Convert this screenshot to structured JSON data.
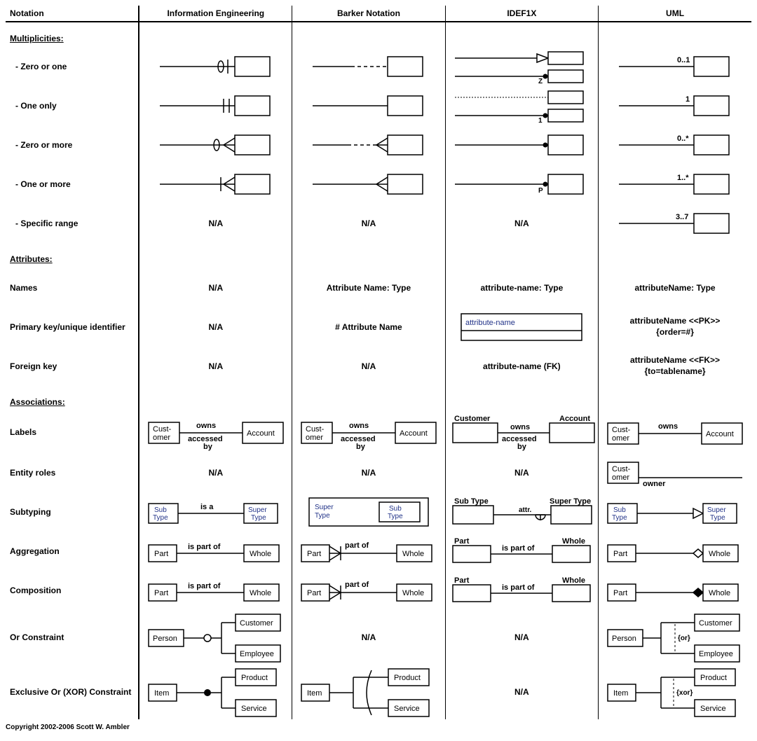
{
  "chart_data": {
    "type": "table",
    "columns": [
      "Notation",
      "Information Engineering",
      "Barker Notation",
      "IDEF1X",
      "UML"
    ],
    "sections": [
      {
        "title": "Multiplicities:",
        "rows": [
          {
            "label": "- Zero or one",
            "cells": [
              "diagram",
              "diagram",
              "diagram",
              "diagram"
            ],
            "uml_label": "0..1",
            "idef1x_label": "Z"
          },
          {
            "label": "- One only",
            "cells": [
              "diagram",
              "diagram",
              "diagram",
              "diagram"
            ],
            "uml_label": "1",
            "idef1x_label": "1"
          },
          {
            "label": "- Zero or more",
            "cells": [
              "diagram",
              "diagram",
              "diagram",
              "diagram"
            ],
            "uml_label": "0..*"
          },
          {
            "label": "- One or more",
            "cells": [
              "diagram",
              "diagram",
              "diagram",
              "diagram"
            ],
            "uml_label": "1..*",
            "idef1x_label": "P"
          },
          {
            "label": "- Specific range",
            "cells": [
              "N/A",
              "N/A",
              "N/A",
              "diagram"
            ],
            "uml_label": "3..7"
          }
        ]
      },
      {
        "title": "Attributes:",
        "rows": [
          {
            "label": "Names",
            "cells": [
              "N/A",
              "Attribute Name: Type",
              "attribute-name: Type",
              "attributeName: Type"
            ]
          },
          {
            "label": "Primary key/unique identifier",
            "cells": [
              "N/A",
              "# Attribute Name",
              "diagram-pkbox",
              "attributeName <<PK>> {order=#}"
            ]
          },
          {
            "label": "Foreign key",
            "cells": [
              "N/A",
              "N/A",
              "attribute-name (FK)",
              "attributeName <<FK>> {to=tablename}"
            ]
          }
        ]
      },
      {
        "title": "Associations:",
        "rows": [
          {
            "label": "Labels",
            "cells": [
              "Customer owns / accessed by Account",
              "Customer owns / accessed by Account",
              "Customer owns / accessed by Account",
              "Customer owns Account"
            ]
          },
          {
            "label": "Entity roles",
            "cells": [
              "N/A",
              "N/A",
              "N/A",
              "Customer owner"
            ]
          },
          {
            "label": "Subtyping",
            "cells": [
              "SubType is a SuperType",
              "SuperType contains SubType",
              "SubType attr. SuperType",
              "SubType ▷ SuperType"
            ]
          },
          {
            "label": "Aggregation",
            "cells": [
              "Part is part of Whole",
              "Part part of Whole",
              "Part is part of Whole",
              "Part ◇ Whole"
            ]
          },
          {
            "label": "Composition",
            "cells": [
              "Part is part of Whole",
              "Part part of Whole",
              "Part is part of Whole",
              "Part ◆ Whole"
            ]
          },
          {
            "label": "Or Constraint",
            "cells": [
              "Person→Customer/Employee",
              "N/A",
              "N/A",
              "Person {or} Customer/Employee"
            ]
          },
          {
            "label": "Exclusive Or (XOR) Constraint",
            "cells": [
              "Item→Product/Service",
              "Item arc Product/Service",
              "N/A",
              "Item {xor} Product/Service"
            ]
          }
        ]
      }
    ]
  },
  "headers": {
    "c0": "Notation",
    "c1": "Information Engineering",
    "c2": "Barker Notation",
    "c3": "IDEF1X",
    "c4": "UML"
  },
  "sections": {
    "mult": "Multiplicities:",
    "attr": "Attributes:",
    "assoc": "Associations:"
  },
  "rows": {
    "zero_one": "- Zero or one",
    "one_only": "- One only",
    "zero_more": "- Zero or more",
    "one_more": "- One or more",
    "specific": "- Specific range",
    "names": "Names",
    "pk": "Primary key/unique identifier",
    "fk": "Foreign key",
    "labels": "Labels",
    "roles": "Entity roles",
    "subtype": "Subtyping",
    "aggreg": "Aggregation",
    "compos": "Composition",
    "orc": "Or Constraint",
    "xor": "Exclusive Or (XOR) Constraint"
  },
  "text": {
    "na": "N/A",
    "attr_barker": "Attribute Name: Type",
    "attr_idef": "attribute-name: Type",
    "attr_uml": "attributeName: Type",
    "pk_barker": "# Attribute Name",
    "pk_idef_box": "attribute-name",
    "pk_uml_l1": "attributeName <<PK>>",
    "pk_uml_l2": "{order=#}",
    "fk_idef": "attribute-name (FK)",
    "fk_uml_l1": "attributeName <<FK>>",
    "fk_uml_l2": "{to=tablename}",
    "uml_01": "0..1",
    "uml_1": "1",
    "uml_0s": "0..*",
    "uml_1s": "1..*",
    "uml_37": "3..7",
    "idef_z": "Z",
    "idef_1": "1",
    "idef_p": "P",
    "customer": "Customer",
    "cust": "Cust-",
    "omer": "omer",
    "account": "Account",
    "owns": "owns",
    "accessed": "accessed",
    "by": "by",
    "owner": "owner",
    "sub": "Sub",
    "type": "Type",
    "super": "Super",
    "subtype": "Sub Type",
    "supertype": "Super Type",
    "is_a": "is a",
    "attr_dot": "attr.",
    "part": "Part",
    "whole": "Whole",
    "is_part_of": "is part of",
    "part_of": "part of",
    "person": "Person",
    "employee": "Employee",
    "item": "Item",
    "product": "Product",
    "service": "Service",
    "or": "{or}",
    "xor": "{xor}"
  },
  "copyright": "Copyright 2002-2006 Scott W. Ambler"
}
